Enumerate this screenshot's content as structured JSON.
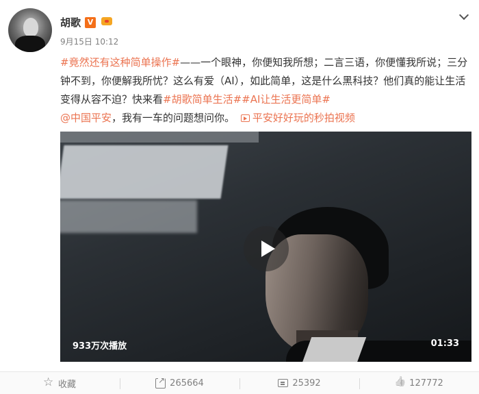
{
  "author": {
    "name": "胡歌",
    "verified_badge": "V",
    "member_badge": "crown-icon"
  },
  "post": {
    "timestamp": "9月15日 10:12",
    "segments": [
      {
        "text": "#竟然还有这种简单操作#",
        "link": true
      },
      {
        "text": "——一个眼神，你便知我所想；二言三语，你便懂我所说；三分钟不到，你便解我所忧？这么有爱（AI），如此简单，这是什么黑科技？他们真的能让生活变得从容不迫？快来看",
        "link": false
      },
      {
        "text": "#胡歌简单生活#",
        "link": true
      },
      {
        "text": "#AI让生活更简单#",
        "link": true
      },
      {
        "text": " ",
        "link": false
      },
      {
        "text": "@中国平安",
        "link": true
      },
      {
        "text": "，我有一车的问题想问你。",
        "link": false
      }
    ],
    "video_link_label": "平安好好玩的秒拍视频"
  },
  "video": {
    "views": "933万次播放",
    "duration": "01:33"
  },
  "actions": {
    "favorite_label": "收藏",
    "share_count": "265664",
    "comment_count": "25392",
    "like_count": "127772"
  },
  "colors": {
    "link": "#eb7350",
    "text": "#333333",
    "muted": "#808080"
  }
}
